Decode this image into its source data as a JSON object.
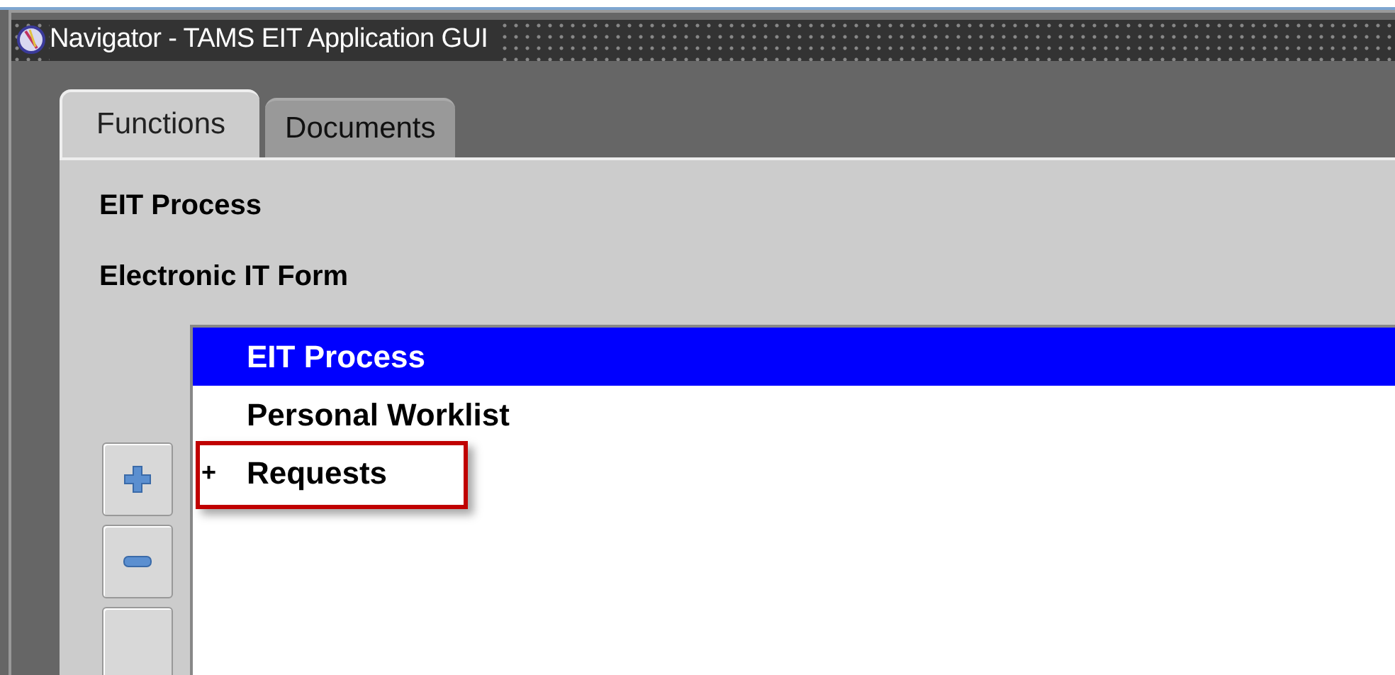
{
  "window": {
    "title": "Navigator - TAMS EIT Application GUI"
  },
  "tabs": [
    {
      "label": "Functions",
      "selected": true
    },
    {
      "label": "Documents",
      "selected": false
    }
  ],
  "heading": "EIT Process",
  "subheading": "Electronic IT Form",
  "tree": {
    "items": [
      {
        "label": "EIT Process",
        "selected": true,
        "highlighted": false
      },
      {
        "label": "Personal Worklist",
        "selected": false,
        "highlighted": false
      },
      {
        "label": "Requests",
        "marker": "+",
        "selected": false,
        "highlighted": true
      }
    ]
  },
  "side_buttons": [
    {
      "kind": "expand"
    },
    {
      "kind": "collapse"
    },
    {
      "kind": "blank"
    }
  ]
}
